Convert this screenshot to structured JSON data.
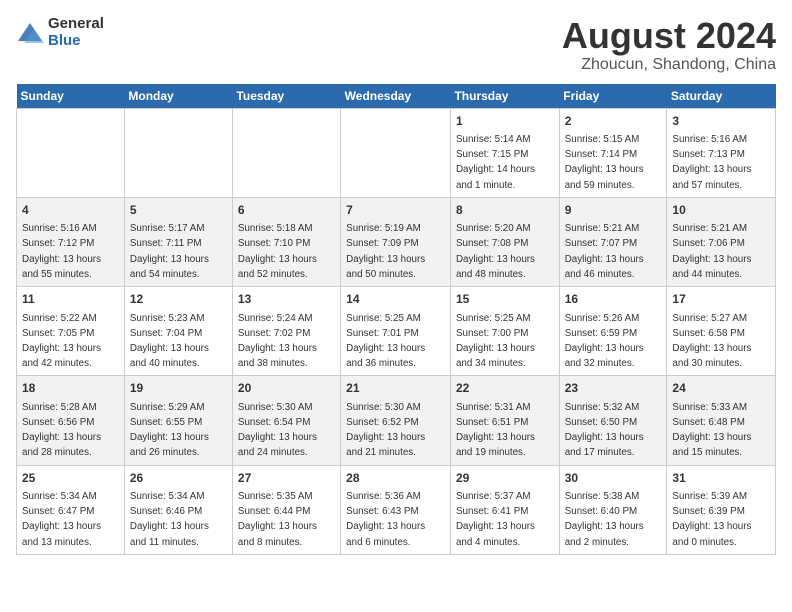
{
  "header": {
    "logo_general": "General",
    "logo_blue": "Blue",
    "month_title": "August 2024",
    "location": "Zhoucun, Shandong, China"
  },
  "weekdays": [
    "Sunday",
    "Monday",
    "Tuesday",
    "Wednesday",
    "Thursday",
    "Friday",
    "Saturday"
  ],
  "weeks": [
    [
      {
        "day": "",
        "info": ""
      },
      {
        "day": "",
        "info": ""
      },
      {
        "day": "",
        "info": ""
      },
      {
        "day": "",
        "info": ""
      },
      {
        "day": "1",
        "info": "Sunrise: 5:14 AM\nSunset: 7:15 PM\nDaylight: 14 hours\nand 1 minute."
      },
      {
        "day": "2",
        "info": "Sunrise: 5:15 AM\nSunset: 7:14 PM\nDaylight: 13 hours\nand 59 minutes."
      },
      {
        "day": "3",
        "info": "Sunrise: 5:16 AM\nSunset: 7:13 PM\nDaylight: 13 hours\nand 57 minutes."
      }
    ],
    [
      {
        "day": "4",
        "info": "Sunrise: 5:16 AM\nSunset: 7:12 PM\nDaylight: 13 hours\nand 55 minutes."
      },
      {
        "day": "5",
        "info": "Sunrise: 5:17 AM\nSunset: 7:11 PM\nDaylight: 13 hours\nand 54 minutes."
      },
      {
        "day": "6",
        "info": "Sunrise: 5:18 AM\nSunset: 7:10 PM\nDaylight: 13 hours\nand 52 minutes."
      },
      {
        "day": "7",
        "info": "Sunrise: 5:19 AM\nSunset: 7:09 PM\nDaylight: 13 hours\nand 50 minutes."
      },
      {
        "day": "8",
        "info": "Sunrise: 5:20 AM\nSunset: 7:08 PM\nDaylight: 13 hours\nand 48 minutes."
      },
      {
        "day": "9",
        "info": "Sunrise: 5:21 AM\nSunset: 7:07 PM\nDaylight: 13 hours\nand 46 minutes."
      },
      {
        "day": "10",
        "info": "Sunrise: 5:21 AM\nSunset: 7:06 PM\nDaylight: 13 hours\nand 44 minutes."
      }
    ],
    [
      {
        "day": "11",
        "info": "Sunrise: 5:22 AM\nSunset: 7:05 PM\nDaylight: 13 hours\nand 42 minutes."
      },
      {
        "day": "12",
        "info": "Sunrise: 5:23 AM\nSunset: 7:04 PM\nDaylight: 13 hours\nand 40 minutes."
      },
      {
        "day": "13",
        "info": "Sunrise: 5:24 AM\nSunset: 7:02 PM\nDaylight: 13 hours\nand 38 minutes."
      },
      {
        "day": "14",
        "info": "Sunrise: 5:25 AM\nSunset: 7:01 PM\nDaylight: 13 hours\nand 36 minutes."
      },
      {
        "day": "15",
        "info": "Sunrise: 5:25 AM\nSunset: 7:00 PM\nDaylight: 13 hours\nand 34 minutes."
      },
      {
        "day": "16",
        "info": "Sunrise: 5:26 AM\nSunset: 6:59 PM\nDaylight: 13 hours\nand 32 minutes."
      },
      {
        "day": "17",
        "info": "Sunrise: 5:27 AM\nSunset: 6:58 PM\nDaylight: 13 hours\nand 30 minutes."
      }
    ],
    [
      {
        "day": "18",
        "info": "Sunrise: 5:28 AM\nSunset: 6:56 PM\nDaylight: 13 hours\nand 28 minutes."
      },
      {
        "day": "19",
        "info": "Sunrise: 5:29 AM\nSunset: 6:55 PM\nDaylight: 13 hours\nand 26 minutes."
      },
      {
        "day": "20",
        "info": "Sunrise: 5:30 AM\nSunset: 6:54 PM\nDaylight: 13 hours\nand 24 minutes."
      },
      {
        "day": "21",
        "info": "Sunrise: 5:30 AM\nSunset: 6:52 PM\nDaylight: 13 hours\nand 21 minutes."
      },
      {
        "day": "22",
        "info": "Sunrise: 5:31 AM\nSunset: 6:51 PM\nDaylight: 13 hours\nand 19 minutes."
      },
      {
        "day": "23",
        "info": "Sunrise: 5:32 AM\nSunset: 6:50 PM\nDaylight: 13 hours\nand 17 minutes."
      },
      {
        "day": "24",
        "info": "Sunrise: 5:33 AM\nSunset: 6:48 PM\nDaylight: 13 hours\nand 15 minutes."
      }
    ],
    [
      {
        "day": "25",
        "info": "Sunrise: 5:34 AM\nSunset: 6:47 PM\nDaylight: 13 hours\nand 13 minutes."
      },
      {
        "day": "26",
        "info": "Sunrise: 5:34 AM\nSunset: 6:46 PM\nDaylight: 13 hours\nand 11 minutes."
      },
      {
        "day": "27",
        "info": "Sunrise: 5:35 AM\nSunset: 6:44 PM\nDaylight: 13 hours\nand 8 minutes."
      },
      {
        "day": "28",
        "info": "Sunrise: 5:36 AM\nSunset: 6:43 PM\nDaylight: 13 hours\nand 6 minutes."
      },
      {
        "day": "29",
        "info": "Sunrise: 5:37 AM\nSunset: 6:41 PM\nDaylight: 13 hours\nand 4 minutes."
      },
      {
        "day": "30",
        "info": "Sunrise: 5:38 AM\nSunset: 6:40 PM\nDaylight: 13 hours\nand 2 minutes."
      },
      {
        "day": "31",
        "info": "Sunrise: 5:39 AM\nSunset: 6:39 PM\nDaylight: 13 hours\nand 0 minutes."
      }
    ]
  ]
}
